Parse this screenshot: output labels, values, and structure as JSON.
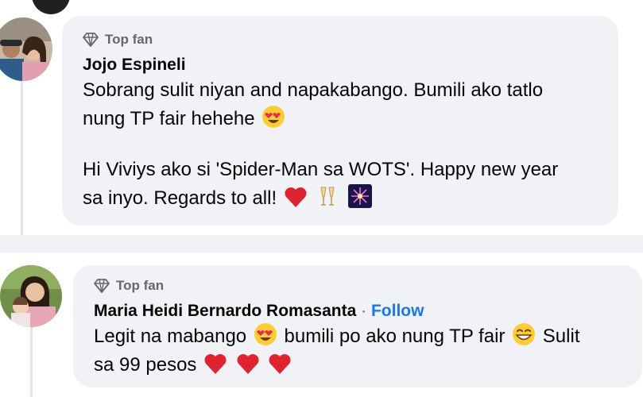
{
  "comments": [
    {
      "badge": "Top fan",
      "author": "Jojo Espineli",
      "text": {
        "p1_line1": "Sobrang sulit niyan and napakabango. Bumili ako tatlo",
        "p1_line2": "nung TP fair hehehe",
        "p2_line1": "Hi Viviys ako si 'Spider-Man sa WOTS'. Happy new year",
        "p2_line2": "sa inyo. Regards to all!"
      },
      "emojis": [
        "heart-eyes",
        "red-heart",
        "champagne-glasses",
        "fireworks"
      ]
    },
    {
      "badge": "Top fan",
      "author": "Maria Heidi Bernardo Romasanta",
      "separator": "·",
      "follow_label": "Follow",
      "text": {
        "line1_a": "Legit na mabango",
        "line1_b": "bumili po ako nung TP fair",
        "line1_c": "Sulit",
        "line2": "sa 99 pesos"
      },
      "emojis": [
        "heart-eyes",
        "grinning-face",
        "red-heart",
        "red-heart",
        "red-heart"
      ]
    }
  ],
  "colors": {
    "background": "#f0f2f5",
    "bubble": "#f0f2f5",
    "card": "#ffffff",
    "link": "#1877f2",
    "secondary_text": "#65676b"
  }
}
